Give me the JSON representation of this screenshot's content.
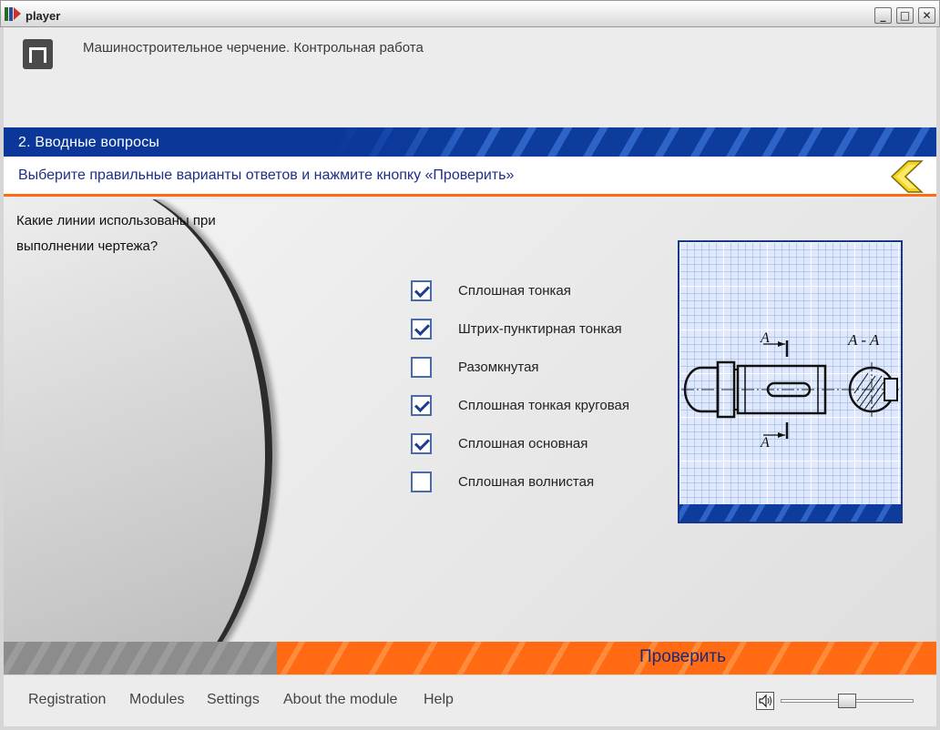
{
  "window": {
    "title": "player",
    "minimize": "_",
    "maximize": "□",
    "close": "✕"
  },
  "header": {
    "course_title": "Машиностроительное черчение. Контрольная работа",
    "logo_icon": "pi-logo-icon"
  },
  "section": {
    "title": "2. Вводные вопросы"
  },
  "instruction": {
    "text": "Выберите правильные варианты ответов и нажмите кнопку «Проверить»",
    "back_icon": "back-arrow-icon"
  },
  "question": {
    "text": "Какие линии использованы при выполнении чертежа?"
  },
  "answers": [
    {
      "label": "Сплошная тонкая",
      "checked": true
    },
    {
      "label": "Штрих-пунктирная тонкая",
      "checked": true
    },
    {
      "label": "Разомкнутая",
      "checked": false
    },
    {
      "label": "Сплошная тонкая круговая",
      "checked": true
    },
    {
      "label": "Сплошная основная",
      "checked": true
    },
    {
      "label": "Сплошная волнистая",
      "checked": false
    }
  ],
  "drawing": {
    "section_label": "A - A",
    "cut_label_top": "A",
    "cut_label_bottom": "A"
  },
  "check_button": {
    "label": "Проверить"
  },
  "footer": {
    "nav": [
      "Registration",
      "Modules",
      "Settings",
      "About the module",
      "Help"
    ],
    "volume_level": 0.5
  },
  "colors": {
    "accent_orange": "#ff6a13",
    "primary_blue": "#0b379a",
    "text_navy": "#1f2f86"
  }
}
